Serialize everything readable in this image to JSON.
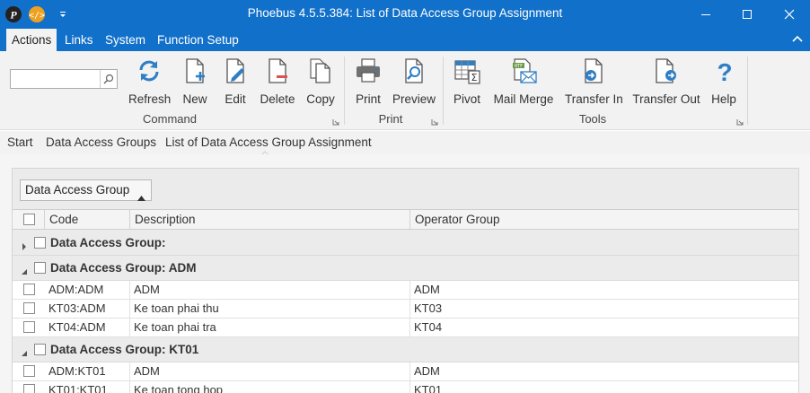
{
  "window": {
    "title": "Phoebus 4.5.5.384: List of Data Access Group Assignment",
    "minimize_icon": "minimize-icon",
    "maximize_icon": "maximize-icon",
    "close_icon": "close-icon"
  },
  "menu": {
    "items": [
      "Actions",
      "Links",
      "System",
      "Function Setup"
    ]
  },
  "ribbon": {
    "search": {
      "value": "",
      "placeholder": ""
    },
    "buttons": {
      "refresh": "Refresh",
      "new": "New",
      "edit": "Edit",
      "delete": "Delete",
      "copy": "Copy",
      "print": "Print",
      "preview": "Preview",
      "pivot": "Pivot",
      "mail_merge": "Mail Merge",
      "transfer_in": "Transfer In",
      "transfer_out": "Transfer Out",
      "help": "Help"
    },
    "groups": {
      "command": "Command",
      "print": "Print",
      "tools": "Tools"
    }
  },
  "breadcrumb": [
    "Start",
    "Data Access Groups",
    "List of Data Access Group Assignment"
  ],
  "grid": {
    "group_by_chip": "Data Access Group",
    "columns": {
      "code": "Code",
      "description": "Description",
      "operator_group": "Operator Group"
    },
    "groups": [
      {
        "label": "Data Access Group:",
        "expanded": false,
        "rows": []
      },
      {
        "label": "Data Access Group: ADM",
        "expanded": true,
        "rows": [
          {
            "code": "ADM:ADM",
            "description": "ADM",
            "operator_group": "ADM"
          },
          {
            "code": "KT03:ADM",
            "description": "Ke toan phai thu",
            "operator_group": "KT03"
          },
          {
            "code": "KT04:ADM",
            "description": "Ke toan phai tra",
            "operator_group": "KT04"
          }
        ]
      },
      {
        "label": "Data Access Group: KT01",
        "expanded": true,
        "rows": [
          {
            "code": "ADM:KT01",
            "description": "ADM",
            "operator_group": "ADM"
          },
          {
            "code": "KT01:KT01",
            "description": "Ke toan tong hop",
            "operator_group": "KT01"
          }
        ]
      }
    ]
  },
  "colors": {
    "title_bar": "#1170c9",
    "ribbon_bg": "#f2f2f2",
    "icon_blue": "#2f7ec6",
    "icon_red": "#d9534f"
  }
}
